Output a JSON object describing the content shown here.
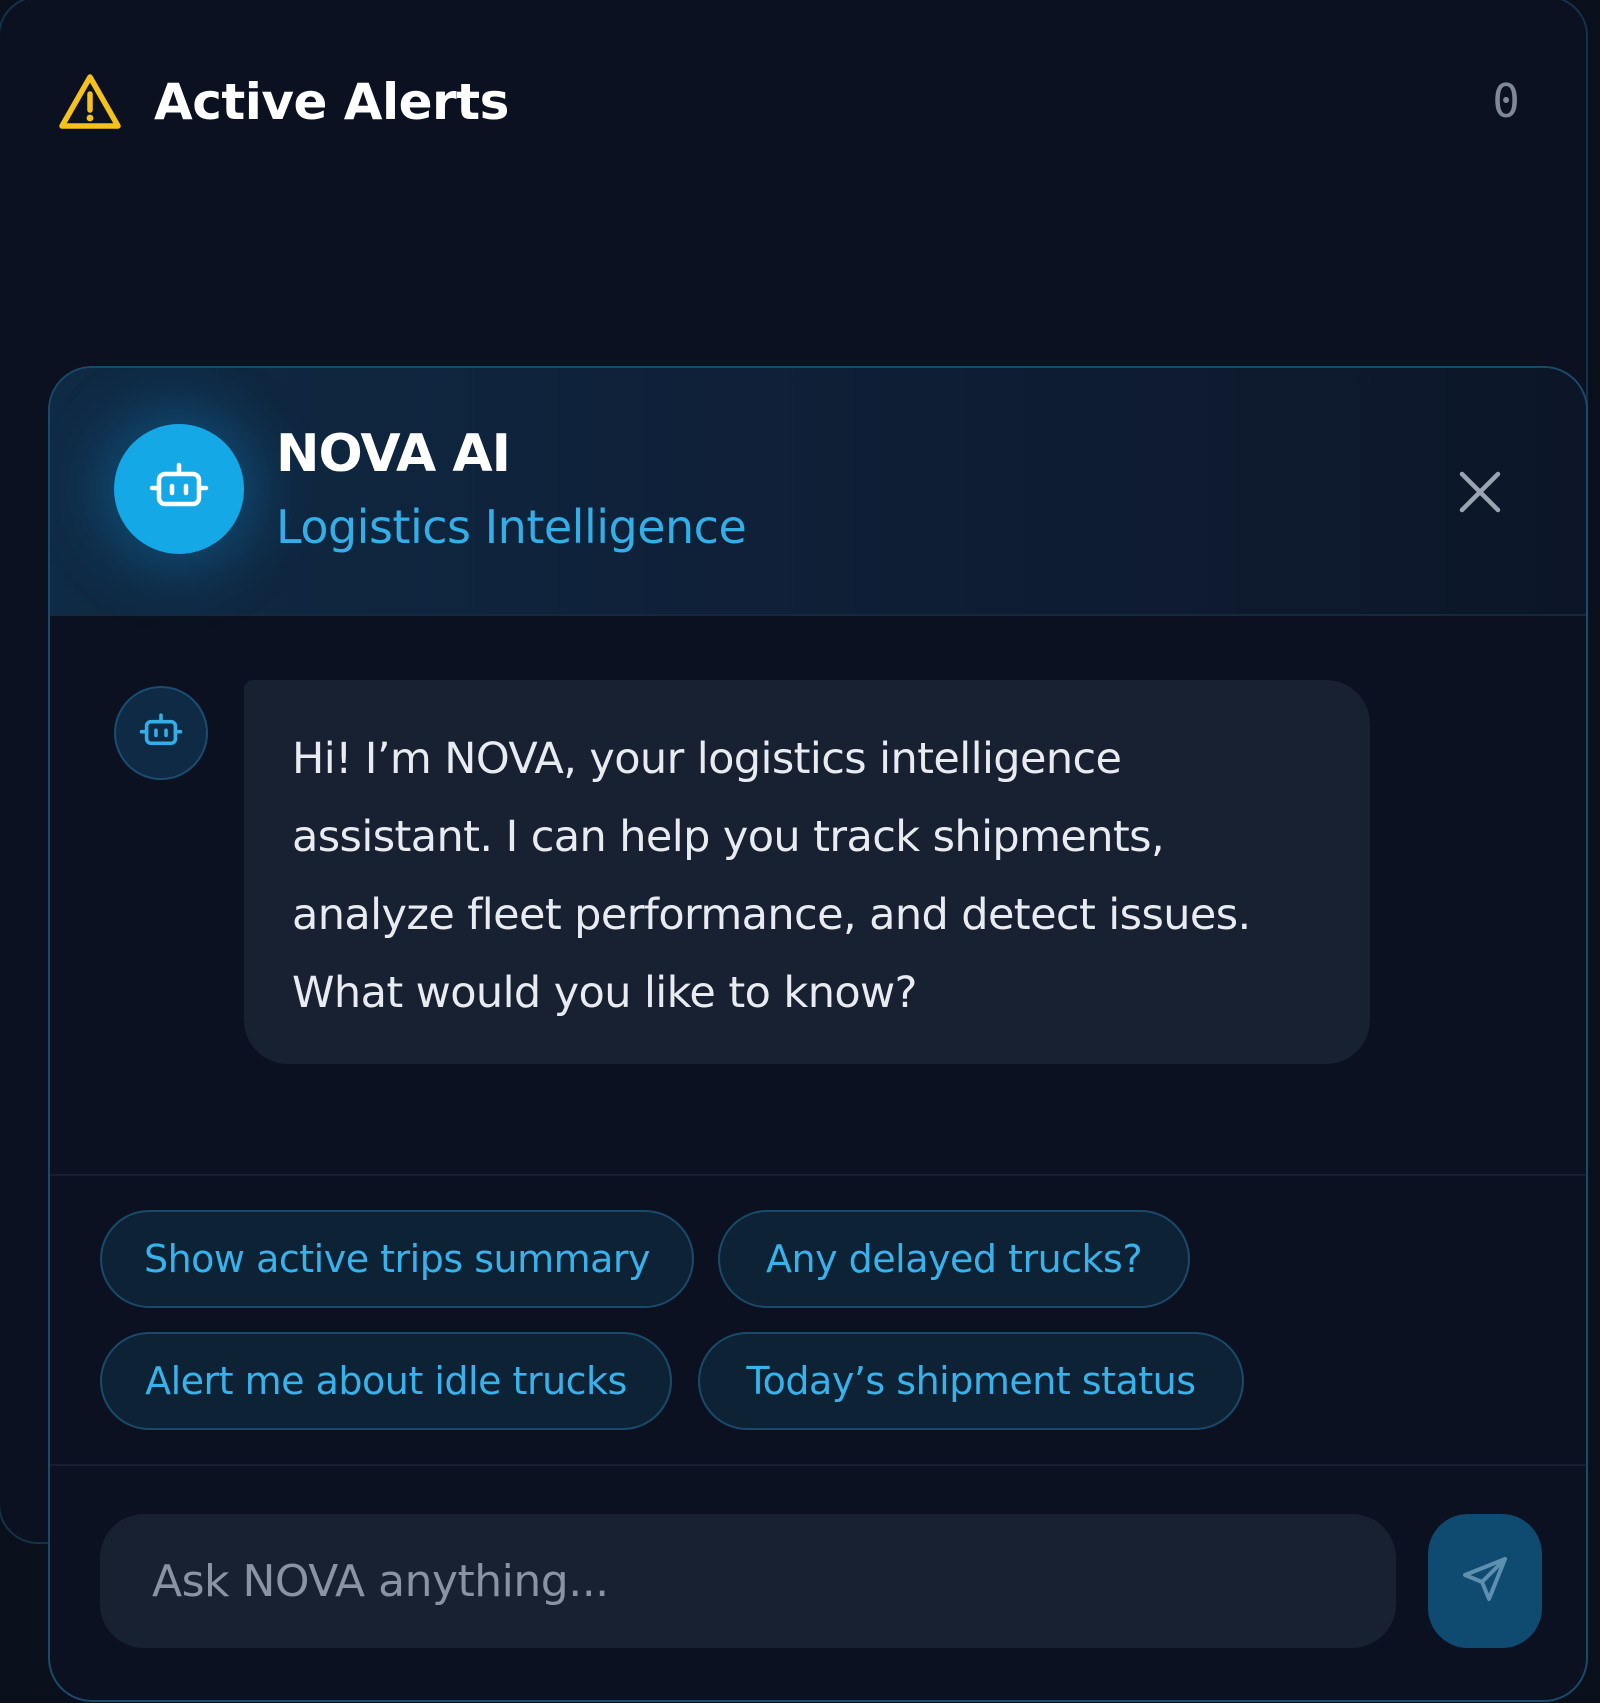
{
  "alerts": {
    "title": "Active Alerts",
    "count": "0",
    "icon": "warning-triangle-icon",
    "icon_color": "#f5c21b"
  },
  "chat": {
    "name": "NOVA AI",
    "subtitle": "Logistics Intelligence",
    "avatar_icon": "robot-icon",
    "close_icon": "close-icon",
    "accent_color": "#14a8e6",
    "messages": [
      {
        "sender": "assistant",
        "text": "Hi! I’m NOVA, your logistics intelligence assistant. I can help you track shipments, analyze fleet performance, and detect issues. What would you like to know?"
      }
    ],
    "suggestions": [
      "Show active trips summary",
      "Any delayed trucks?",
      "Alert me about idle trucks",
      "Today’s shipment status"
    ],
    "input": {
      "placeholder": "Ask NOVA anything...",
      "value": ""
    },
    "send_icon": "send-icon"
  }
}
